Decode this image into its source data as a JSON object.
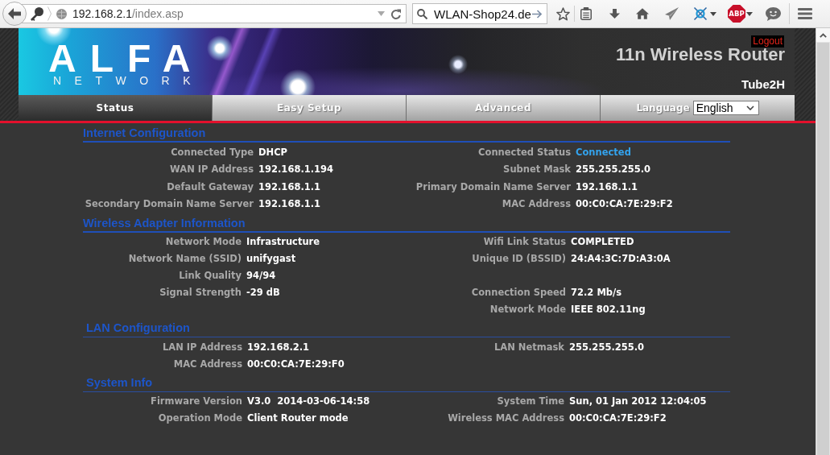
{
  "browser": {
    "address": {
      "host": "192.168.2.1",
      "path": "/index.asp"
    },
    "search": {
      "value": "WLAN-Shop24.de"
    },
    "extension_badge": "ABP"
  },
  "header": {
    "logo": {
      "wordmark": "ALFA",
      "subtitle": "NETWORK"
    },
    "logout": "Logout",
    "product": "11n Wireless Router",
    "model": "Tube2H"
  },
  "nav": {
    "tabs": [
      {
        "label": "Status",
        "selected": true
      },
      {
        "label": "Easy Setup",
        "selected": false
      },
      {
        "label": "Advanced",
        "selected": false
      }
    ],
    "language": {
      "label": "Language",
      "value": "English"
    }
  },
  "sections": [
    {
      "title": "Internet Configuration",
      "rows": [
        {
          "left": {
            "label": "Connected Type",
            "value": "DHCP"
          },
          "right": {
            "label": "Connected Status",
            "value": "Connected",
            "color": "#33a3ee"
          }
        },
        {
          "left": {
            "label": "WAN IP Address",
            "value": "192.168.1.194"
          },
          "right": {
            "label": "Subnet Mask",
            "value": "255.255.255.0"
          }
        },
        {
          "left": {
            "label": "Default Gateway",
            "value": "192.168.1.1"
          },
          "right": {
            "label": "Primary Domain Name Server",
            "value": "192.168.1.1"
          }
        },
        {
          "left": {
            "label": "Secondary Domain Name Server",
            "value": "192.168.1.1"
          },
          "right": {
            "label": "MAC Address",
            "value": "00:C0:CA:7E:29:F2"
          }
        }
      ]
    },
    {
      "title": "Wireless Adapter Information",
      "rows": [
        {
          "left": {
            "label": "Network Mode",
            "value": "Infrastructure"
          },
          "right": {
            "label": "Wifi Link Status",
            "value": "COMPLETED"
          }
        },
        {
          "left": {
            "label": "Network Name (SSID)",
            "value": "unifygast"
          },
          "right": {
            "label": "Unique ID (BSSID)",
            "value": "24:A4:3C:7D:A3:0A"
          }
        },
        {
          "left": {
            "label": "Link Quality",
            "value": "94/94"
          }
        },
        {
          "left": {
            "label": "Signal Strength",
            "value": "-29 dB"
          },
          "right": {
            "label": "Connection Speed",
            "value": "72.2 Mb/s"
          }
        },
        {
          "right": {
            "label": "Network Mode",
            "value": "IEEE 802.11ng"
          }
        }
      ]
    },
    {
      "title": "LAN Configuration",
      "rows": [
        {
          "left": {
            "label": "LAN IP Address",
            "value": "192.168.2.1"
          },
          "right": {
            "label": "LAN Netmask",
            "value": "255.255.255.0"
          }
        },
        {
          "left": {
            "label": "MAC Address",
            "value": "00:C0:CA:7E:29:F0"
          }
        }
      ]
    },
    {
      "title": "System Info",
      "rows": [
        {
          "left": {
            "label": "Firmware Version",
            "value": "V3.0  2014-03-06-14:58"
          },
          "right": {
            "label": "System Time",
            "value": "Sun, 01 Jan 2012 12:04:05"
          }
        },
        {
          "left": {
            "label": "Operation Mode",
            "value": "Client Router mode"
          },
          "right": {
            "label": "Wireless MAC Address",
            "value": "00:C0:CA:7E:29:F2"
          }
        }
      ]
    }
  ]
}
